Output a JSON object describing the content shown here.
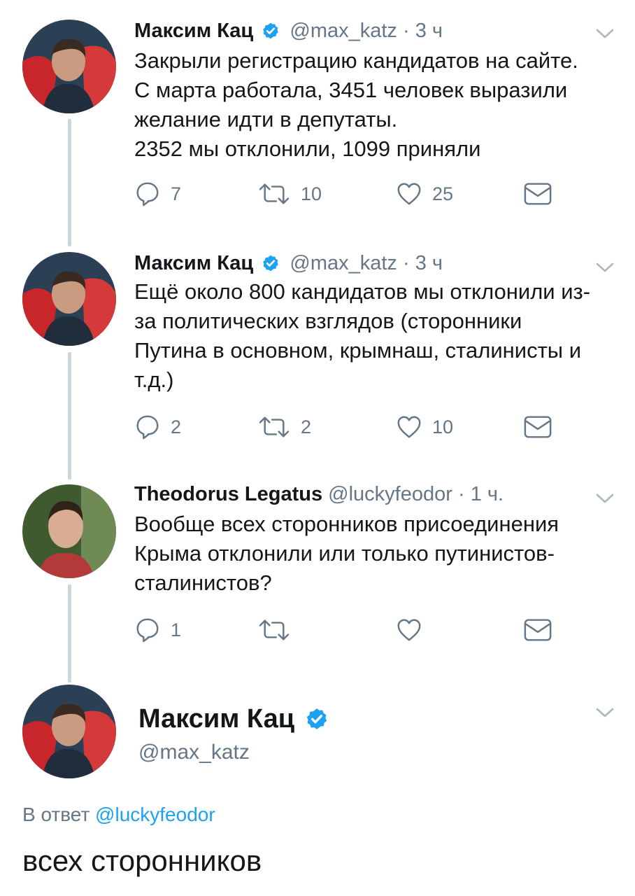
{
  "tweets": [
    {
      "name": "Максим Кац",
      "handle": "@max_katz",
      "separator": "·",
      "time": "3 ч",
      "text_lines": [
        "Закрыли регистрацию кандидатов на сайте.",
        "С марта работала, 3451 человек выразили",
        "желание идти в депутаты.",
        "2352 мы отклонили, 1099 приняли"
      ],
      "replies": "7",
      "retweets": "10",
      "likes": "25"
    },
    {
      "name": "Максим Кац",
      "handle": "@max_katz",
      "separator": "·",
      "time": "3 ч",
      "text_lines": [
        "Ещё около 800 кандидатов мы отклонили из-",
        "за политических взглядов (сторонники",
        "Путина в основном, крымнаш, сталинисты и",
        "т.д.)"
      ],
      "replies": "2",
      "retweets": "2",
      "likes": "10"
    },
    {
      "name": "Theodorus Legatus",
      "handle": "@luckyfeodor",
      "separator": "·",
      "time": "1 ч.",
      "text_lines": [
        "Вообще всех сторонников присоединения",
        "Крыма отклонили или только путинистов-",
        "сталинистов?"
      ],
      "replies": "1",
      "retweets": "",
      "likes": ""
    }
  ],
  "focused": {
    "name": "Максим Кац",
    "handle": "@max_katz",
    "reply_label": "В ответ",
    "reply_mention": "@luckyfeodor",
    "text": "всех сторонников"
  },
  "colors": {
    "verified": "#1da1f2",
    "icon": "#657786",
    "thread_line": "#ccd6dd",
    "mention": "#1da1f2"
  },
  "icons": [
    "verified-badge-icon",
    "chevron-down-icon",
    "reply-icon",
    "retweet-icon",
    "like-icon",
    "direct-message-icon"
  ]
}
